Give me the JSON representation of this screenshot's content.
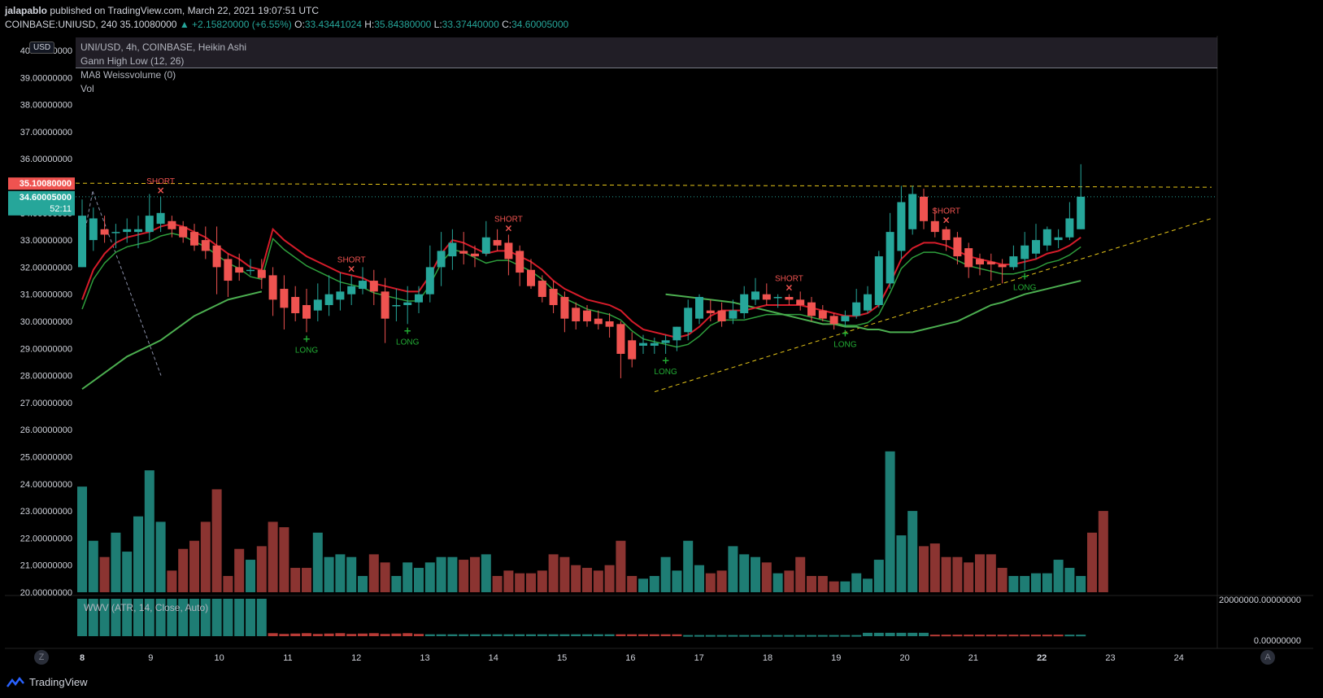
{
  "header": {
    "publisher": "jalapablo",
    "published_text": "published on TradingView.com, March 22, 2021 19:07:51 UTC",
    "symbol_line_prefix": "COINBASE:UNIUSD, 240",
    "last": "35.10080000",
    "change": "▲ +2.15820000 (+6.55%)",
    "o_label": "O:",
    "o": "33.43441024",
    "h_label": "H:",
    "h": "35.84380000",
    "l_label": "L:",
    "l": "33.37440000",
    "c_label": "C:",
    "c": "34.60005000"
  },
  "legend": {
    "line1": "UNI/USD, 4h, COINBASE, Heikin Ashi",
    "line2": "Gann High Low (12, 26)",
    "line3": "MA8 Weissvolume (0)",
    "line4": "Vol"
  },
  "price_scale": {
    "currency_badge": "USD",
    "last_price_tag": "35.10080000",
    "close_tag": "34.60005000",
    "countdown": "52:11"
  },
  "wwv": {
    "label": "WWV (ATR, 14, Close, Auto)",
    "axis_top": "20000000.00000000",
    "axis_zero": "0.00000000"
  },
  "footer": {
    "brand": "TradingView",
    "z_button": "Z",
    "a_button": "A"
  },
  "colors": {
    "up": "#26a69a",
    "down": "#ef5350",
    "vol_up": "#1e7d74",
    "vol_down": "#8b3431",
    "gann": "#d61c2a",
    "ma": "#2e9e3c",
    "ma_slow": "#4caf50",
    "dashed": "#e6c619"
  },
  "chart_data": {
    "type": "candlestick",
    "symbol": "UNI/USD",
    "timeframe": "4h",
    "chart_style": "Heikin Ashi",
    "y_ticks": [
      "40.00000000",
      "39.00000000",
      "38.00000000",
      "37.00000000",
      "36.00000000",
      "35.00000000",
      "34.00000000",
      "33.00000000",
      "32.00000000",
      "31.00000000",
      "30.00000000",
      "29.00000000",
      "28.00000000",
      "27.00000000",
      "26.00000000",
      "25.00000000",
      "24.00000000",
      "23.00000000",
      "22.00000000",
      "21.00000000",
      "20.00000000"
    ],
    "x_ticks": [
      "8",
      "9",
      "10",
      "11",
      "12",
      "13",
      "14",
      "15",
      "16",
      "17",
      "18",
      "19",
      "20",
      "21",
      "22",
      "23",
      "24"
    ],
    "ylim": [
      20,
      40
    ],
    "candles": [
      {
        "o": 32.0,
        "h": 34.5,
        "l": 32.0,
        "c": 33.9
      },
      {
        "o": 33.0,
        "h": 34.2,
        "l": 32.6,
        "c": 33.8
      },
      {
        "o": 33.4,
        "h": 33.9,
        "l": 32.9,
        "c": 33.2
      },
      {
        "o": 33.3,
        "h": 33.6,
        "l": 32.7,
        "c": 33.3
      },
      {
        "o": 33.3,
        "h": 33.8,
        "l": 32.9,
        "c": 33.4
      },
      {
        "o": 33.3,
        "h": 33.9,
        "l": 32.7,
        "c": 33.4
      },
      {
        "o": 33.3,
        "h": 34.7,
        "l": 33.0,
        "c": 33.9
      },
      {
        "o": 33.6,
        "h": 34.6,
        "l": 33.3,
        "c": 34.0
      },
      {
        "o": 33.7,
        "h": 33.9,
        "l": 33.1,
        "c": 33.4
      },
      {
        "o": 33.5,
        "h": 33.7,
        "l": 32.9,
        "c": 33.1
      },
      {
        "o": 33.3,
        "h": 33.6,
        "l": 32.6,
        "c": 32.8
      },
      {
        "o": 33.0,
        "h": 33.5,
        "l": 32.3,
        "c": 32.6
      },
      {
        "o": 32.8,
        "h": 33.5,
        "l": 31.0,
        "c": 32.0
      },
      {
        "o": 32.3,
        "h": 32.5,
        "l": 30.9,
        "c": 31.5
      },
      {
        "o": 32.0,
        "h": 32.5,
        "l": 31.5,
        "c": 31.8
      },
      {
        "o": 31.9,
        "h": 32.3,
        "l": 31.7,
        "c": 31.9
      },
      {
        "o": 31.9,
        "h": 32.3,
        "l": 31.2,
        "c": 31.6
      },
      {
        "o": 31.7,
        "h": 32.0,
        "l": 30.2,
        "c": 30.8
      },
      {
        "o": 31.2,
        "h": 31.7,
        "l": 29.7,
        "c": 30.5
      },
      {
        "o": 30.9,
        "h": 31.3,
        "l": 30.0,
        "c": 30.3
      },
      {
        "o": 30.6,
        "h": 31.2,
        "l": 29.6,
        "c": 30.1
      },
      {
        "o": 30.4,
        "h": 31.4,
        "l": 30.0,
        "c": 30.8
      },
      {
        "o": 30.6,
        "h": 31.7,
        "l": 30.2,
        "c": 31.0
      },
      {
        "o": 30.8,
        "h": 31.8,
        "l": 30.4,
        "c": 31.1
      },
      {
        "o": 31.0,
        "h": 31.7,
        "l": 30.6,
        "c": 31.3
      },
      {
        "o": 31.2,
        "h": 32.0,
        "l": 31.0,
        "c": 31.5
      },
      {
        "o": 31.5,
        "h": 31.9,
        "l": 30.6,
        "c": 31.1
      },
      {
        "o": 31.1,
        "h": 31.6,
        "l": 29.2,
        "c": 30.1
      },
      {
        "o": 30.6,
        "h": 31.2,
        "l": 30.0,
        "c": 30.6
      },
      {
        "o": 30.6,
        "h": 31.3,
        "l": 29.9,
        "c": 30.7
      },
      {
        "o": 30.7,
        "h": 31.3,
        "l": 30.3,
        "c": 31.0
      },
      {
        "o": 31.0,
        "h": 32.8,
        "l": 30.7,
        "c": 32.0
      },
      {
        "o": 32.0,
        "h": 33.3,
        "l": 31.3,
        "c": 32.6
      },
      {
        "o": 32.4,
        "h": 33.4,
        "l": 31.9,
        "c": 32.9
      },
      {
        "o": 32.6,
        "h": 33.3,
        "l": 32.1,
        "c": 32.5
      },
      {
        "o": 32.5,
        "h": 32.8,
        "l": 32.0,
        "c": 32.4
      },
      {
        "o": 32.5,
        "h": 33.7,
        "l": 32.4,
        "c": 33.1
      },
      {
        "o": 33.0,
        "h": 33.4,
        "l": 32.6,
        "c": 32.8
      },
      {
        "o": 32.9,
        "h": 33.2,
        "l": 31.7,
        "c": 32.3
      },
      {
        "o": 32.6,
        "h": 32.8,
        "l": 31.3,
        "c": 31.8
      },
      {
        "o": 31.9,
        "h": 32.3,
        "l": 31.2,
        "c": 31.3
      },
      {
        "o": 31.5,
        "h": 31.7,
        "l": 30.7,
        "c": 30.9
      },
      {
        "o": 31.2,
        "h": 31.5,
        "l": 30.3,
        "c": 30.6
      },
      {
        "o": 30.9,
        "h": 31.1,
        "l": 29.6,
        "c": 30.1
      },
      {
        "o": 30.5,
        "h": 30.7,
        "l": 29.7,
        "c": 30.0
      },
      {
        "o": 30.4,
        "h": 30.6,
        "l": 29.8,
        "c": 30.0
      },
      {
        "o": 30.1,
        "h": 30.4,
        "l": 29.7,
        "c": 29.9
      },
      {
        "o": 30.0,
        "h": 30.3,
        "l": 29.4,
        "c": 29.8
      },
      {
        "o": 29.9,
        "h": 30.0,
        "l": 27.9,
        "c": 28.8
      },
      {
        "o": 29.3,
        "h": 29.6,
        "l": 28.3,
        "c": 28.6
      },
      {
        "o": 29.1,
        "h": 29.5,
        "l": 28.8,
        "c": 29.2
      },
      {
        "o": 29.1,
        "h": 29.4,
        "l": 28.8,
        "c": 29.2
      },
      {
        "o": 29.2,
        "h": 29.5,
        "l": 28.8,
        "c": 29.3
      },
      {
        "o": 29.3,
        "h": 29.8,
        "l": 28.9,
        "c": 29.8
      },
      {
        "o": 29.6,
        "h": 30.8,
        "l": 29.3,
        "c": 30.5
      },
      {
        "o": 30.1,
        "h": 31.0,
        "l": 29.9,
        "c": 30.9
      },
      {
        "o": 30.4,
        "h": 30.8,
        "l": 30.0,
        "c": 30.3
      },
      {
        "o": 30.4,
        "h": 30.7,
        "l": 29.8,
        "c": 30.0
      },
      {
        "o": 30.1,
        "h": 30.8,
        "l": 29.9,
        "c": 30.4
      },
      {
        "o": 30.3,
        "h": 31.3,
        "l": 30.1,
        "c": 31.0
      },
      {
        "o": 30.8,
        "h": 31.6,
        "l": 30.6,
        "c": 31.1
      },
      {
        "o": 31.0,
        "h": 31.4,
        "l": 30.6,
        "c": 30.8
      },
      {
        "o": 30.9,
        "h": 31.0,
        "l": 30.5,
        "c": 30.9
      },
      {
        "o": 30.9,
        "h": 31.0,
        "l": 30.6,
        "c": 30.8
      },
      {
        "o": 30.8,
        "h": 31.1,
        "l": 30.4,
        "c": 30.6
      },
      {
        "o": 30.7,
        "h": 30.9,
        "l": 30.0,
        "c": 30.2
      },
      {
        "o": 30.4,
        "h": 30.6,
        "l": 30.0,
        "c": 30.1
      },
      {
        "o": 30.2,
        "h": 30.3,
        "l": 29.7,
        "c": 29.9
      },
      {
        "o": 30.0,
        "h": 30.4,
        "l": 29.8,
        "c": 30.2
      },
      {
        "o": 30.2,
        "h": 31.2,
        "l": 30.1,
        "c": 30.7
      },
      {
        "o": 30.4,
        "h": 31.3,
        "l": 30.3,
        "c": 31.0
      },
      {
        "o": 30.6,
        "h": 32.6,
        "l": 30.5,
        "c": 32.4
      },
      {
        "o": 31.4,
        "h": 34.0,
        "l": 31.2,
        "c": 33.3
      },
      {
        "o": 32.6,
        "h": 35.0,
        "l": 32.3,
        "c": 34.4
      },
      {
        "o": 33.4,
        "h": 35.0,
        "l": 33.2,
        "c": 34.7
      },
      {
        "o": 34.6,
        "h": 34.9,
        "l": 33.4,
        "c": 33.7
      },
      {
        "o": 33.7,
        "h": 34.2,
        "l": 33.1,
        "c": 33.3
      },
      {
        "o": 33.4,
        "h": 33.5,
        "l": 32.6,
        "c": 33.0
      },
      {
        "o": 33.1,
        "h": 33.3,
        "l": 32.1,
        "c": 32.4
      },
      {
        "o": 32.7,
        "h": 32.9,
        "l": 31.6,
        "c": 32.0
      },
      {
        "o": 32.3,
        "h": 32.5,
        "l": 31.7,
        "c": 32.1
      },
      {
        "o": 32.2,
        "h": 32.5,
        "l": 31.5,
        "c": 32.1
      },
      {
        "o": 32.1,
        "h": 32.3,
        "l": 31.4,
        "c": 32.0
      },
      {
        "o": 32.0,
        "h": 32.8,
        "l": 31.9,
        "c": 32.4
      },
      {
        "o": 32.3,
        "h": 33.3,
        "l": 31.9,
        "c": 32.8
      },
      {
        "o": 32.5,
        "h": 33.6,
        "l": 32.3,
        "c": 33.0
      },
      {
        "o": 32.8,
        "h": 33.5,
        "l": 32.6,
        "c": 33.4
      },
      {
        "o": 33.0,
        "h": 33.4,
        "l": 32.7,
        "c": 33.1
      },
      {
        "o": 33.1,
        "h": 34.4,
        "l": 33.0,
        "c": 33.8
      },
      {
        "o": 33.4,
        "h": 35.8,
        "l": 33.4,
        "c": 34.6
      }
    ],
    "volume": [
      23.9,
      21.9,
      21.3,
      22.2,
      21.5,
      22.8,
      24.5,
      22.6,
      20.8,
      21.6,
      21.9,
      22.6,
      23.8,
      20.6,
      21.6,
      21.2,
      21.7,
      22.6,
      22.4,
      20.9,
      20.9,
      22.2,
      21.3,
      21.4,
      21.3,
      20.6,
      21.4,
      21.1,
      20.6,
      21.1,
      20.9,
      21.1,
      21.3,
      21.3,
      21.2,
      21.3,
      21.4,
      20.6,
      20.8,
      20.7,
      20.7,
      20.8,
      21.4,
      21.3,
      21.0,
      20.9,
      20.8,
      21.0,
      21.9,
      20.6,
      20.5,
      20.6,
      21.3,
      20.8,
      21.9,
      21.0,
      20.7,
      20.8,
      21.7,
      21.4,
      21.3,
      21.1,
      20.7,
      20.8,
      21.3,
      20.6,
      20.6,
      20.4,
      20.4,
      20.7,
      20.5,
      21.2,
      25.2,
      22.1,
      23.0,
      21.7,
      21.8,
      21.3,
      21.3,
      21.1,
      21.4,
      21.4,
      20.9,
      20.6,
      20.6,
      20.7,
      20.7,
      21.2,
      20.9,
      20.6,
      22.2,
      23.0
    ],
    "gann_line_sample": [
      30.8,
      31.9,
      32.5,
      32.9,
      33.1,
      33.2,
      33.3,
      33.5,
      33.6,
      33.5,
      33.3,
      33.1,
      32.8,
      32.5,
      32.3,
      32.0,
      31.9,
      33.4,
      33.0,
      32.7,
      32.4,
      32.2,
      32.0,
      31.8,
      31.7,
      31.6,
      31.4,
      31.3,
      31.2,
      31.1,
      31.1,
      31.7,
      32.5,
      33.0,
      32.9,
      32.7,
      32.5,
      32.6,
      32.6,
      32.4,
      32.2,
      31.9,
      31.5,
      31.2,
      31.0,
      30.8,
      30.7,
      30.6,
      30.4,
      30.0,
      29.7,
      29.6,
      29.5,
      29.4,
      29.5,
      29.8,
      30.2,
      30.4,
      30.4,
      30.4,
      30.5,
      30.6,
      30.6,
      30.6,
      30.6,
      30.5,
      30.4,
      30.3,
      30.2,
      30.2,
      30.3,
      30.6,
      31.4,
      32.3,
      32.7,
      32.9,
      32.9,
      32.8,
      32.6,
      32.4,
      32.3,
      32.2,
      32.1,
      32.1,
      32.2,
      32.3,
      32.5,
      32.6,
      32.8,
      33.1
    ],
    "ma_slow_sample": [
      27.5,
      27.8,
      28.1,
      28.4,
      28.7,
      28.9,
      29.1,
      29.3,
      29.6,
      29.9,
      30.2,
      30.4,
      30.6,
      30.8,
      30.9,
      31.0,
      31.1,
      null
    ],
    "signals": [
      {
        "type": "SHORT",
        "index": 7
      },
      {
        "type": "LONG",
        "index": 20
      },
      {
        "type": "SHORT",
        "index": 24
      },
      {
        "type": "LONG",
        "index": 29
      },
      {
        "type": "SHORT",
        "index": 38
      },
      {
        "type": "LONG",
        "index": 52
      },
      {
        "type": "SHORT",
        "index": 63
      },
      {
        "type": "LONG",
        "index": 68
      },
      {
        "type": "SHORT",
        "index": 77
      },
      {
        "type": "LONG",
        "index": 84
      }
    ],
    "signal_labels": {
      "SHORT": "SHORT",
      "LONG": "LONG"
    },
    "resistance_level": 35.1,
    "last_close_level": 34.6
  }
}
